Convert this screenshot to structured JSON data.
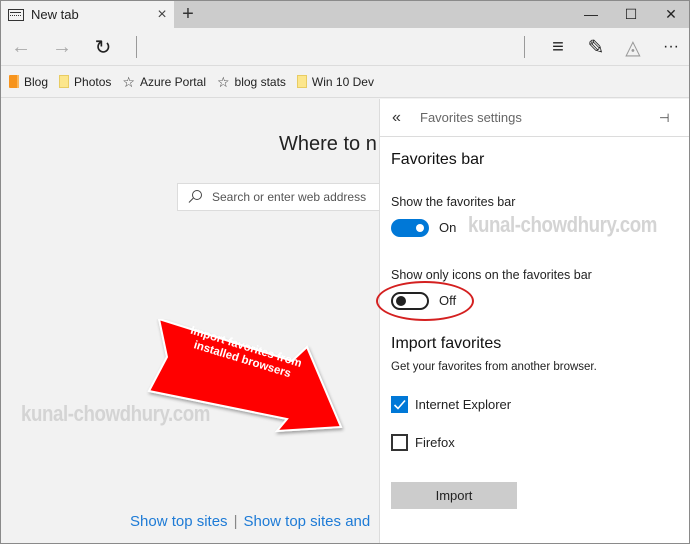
{
  "browser": {
    "tab_title": "New tab",
    "tab_close_glyph": "×",
    "new_tab_glyph": "+",
    "window_controls": {
      "minimize": "—",
      "maximize": "☐",
      "close": "✕"
    },
    "nav": {
      "back": "←",
      "forward": "→",
      "refresh": "↻",
      "hub": "≡",
      "note": "✎",
      "share": "◬",
      "more": "···"
    }
  },
  "favorites_bar": {
    "items": [
      {
        "label": "Blog",
        "icon": "bookmark-icon"
      },
      {
        "label": "Photos",
        "icon": "folder-icon"
      },
      {
        "label": "Azure Portal",
        "icon": "star-icon"
      },
      {
        "label": "blog stats",
        "icon": "star-icon"
      },
      {
        "label": "Win 10 Dev",
        "icon": "folder-icon"
      }
    ],
    "star_glyph": "☆"
  },
  "new_tab_page": {
    "heading": "Where to n",
    "search_placeholder": "Search or enter web address",
    "links": [
      "Show top sites",
      "Show top sites and"
    ],
    "link_separator": "|"
  },
  "annotation": {
    "arrow_text": "Import favorites from installed browsers",
    "arrow_color": "#ff0000",
    "watermark": "kunal-chowdhury.com",
    "highlight_color": "#d42020"
  },
  "panel": {
    "back_glyph": "«",
    "title": "Favorites settings",
    "pin_glyph": "⊣",
    "favorites_bar_section": {
      "title": "Favorites bar",
      "show_bar_label": "Show the favorites bar",
      "show_bar_state": "On",
      "icons_only_label": "Show only icons on the favorites bar",
      "icons_only_state": "Off"
    },
    "import_section": {
      "title": "Import favorites",
      "description": "Get your favorites from another browser.",
      "browsers": [
        {
          "label": "Internet Explorer",
          "checked": true
        },
        {
          "label": "Firefox",
          "checked": false
        }
      ],
      "import_button": "Import"
    },
    "accent_color": "#0078d7"
  }
}
